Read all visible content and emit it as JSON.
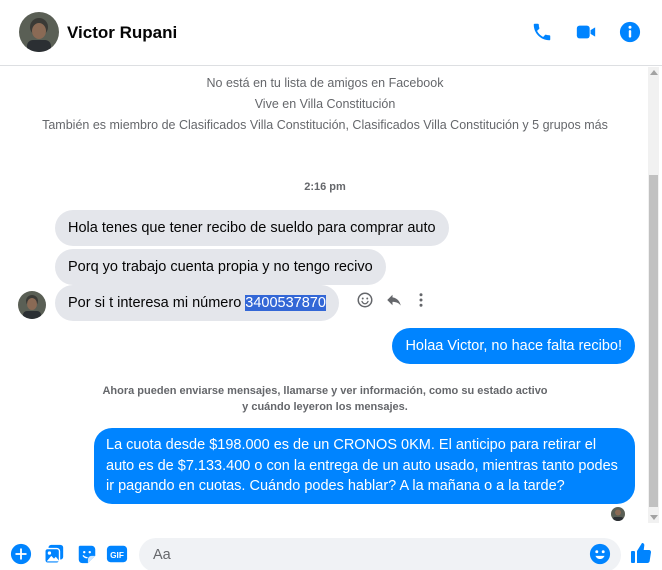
{
  "header": {
    "contact_name": "Victor Rupani",
    "icons": [
      "phone-icon",
      "video-camera-icon",
      "info-icon"
    ]
  },
  "info": {
    "line1": "No está en tu lista de amigos en Facebook",
    "line2": "Vive en Villa Constitución",
    "line3": "También es miembro de Clasificados Villa Constitución, Clasificados Villa Constitución y 5 grupos más"
  },
  "timestamp": "2:16 pm",
  "incoming": [
    {
      "text": "Hola tenes que tener recibo de sueldo para comprar auto"
    },
    {
      "text": "Porq yo trabajo cuenta propia y no tengo recivo"
    },
    {
      "text_before": "Por si t interesa  mi número ",
      "highlighted": "3400537870"
    }
  ],
  "outgoing": [
    {
      "text": "Holaa Victor, no hace falta recibo!"
    },
    {
      "text": "La cuota desde $198.000 es de un CRONOS 0KM. El anticipo para retirar el auto es de $7.133.400 o con la entrega de un auto usado, mientras tanto podes ir pagando en cuotas. Cuándo podes hablar? A la mañana o a la tarde?"
    }
  ],
  "notice": "Ahora pueden enviarse mensajes, llamarse y ver información, como su estado activo y cuándo leyeron los mensajes.",
  "composer": {
    "placeholder": "Aa",
    "icons": [
      "plus-circle-icon",
      "image-icon",
      "sticker-icon",
      "gif-icon",
      "emoji-icon",
      "thumbs-up-icon"
    ]
  },
  "colors": {
    "accent": "#0084ff",
    "incoming_bubble": "#e4e6eb",
    "meta_text": "#65676b",
    "selection": "#3367d6"
  }
}
